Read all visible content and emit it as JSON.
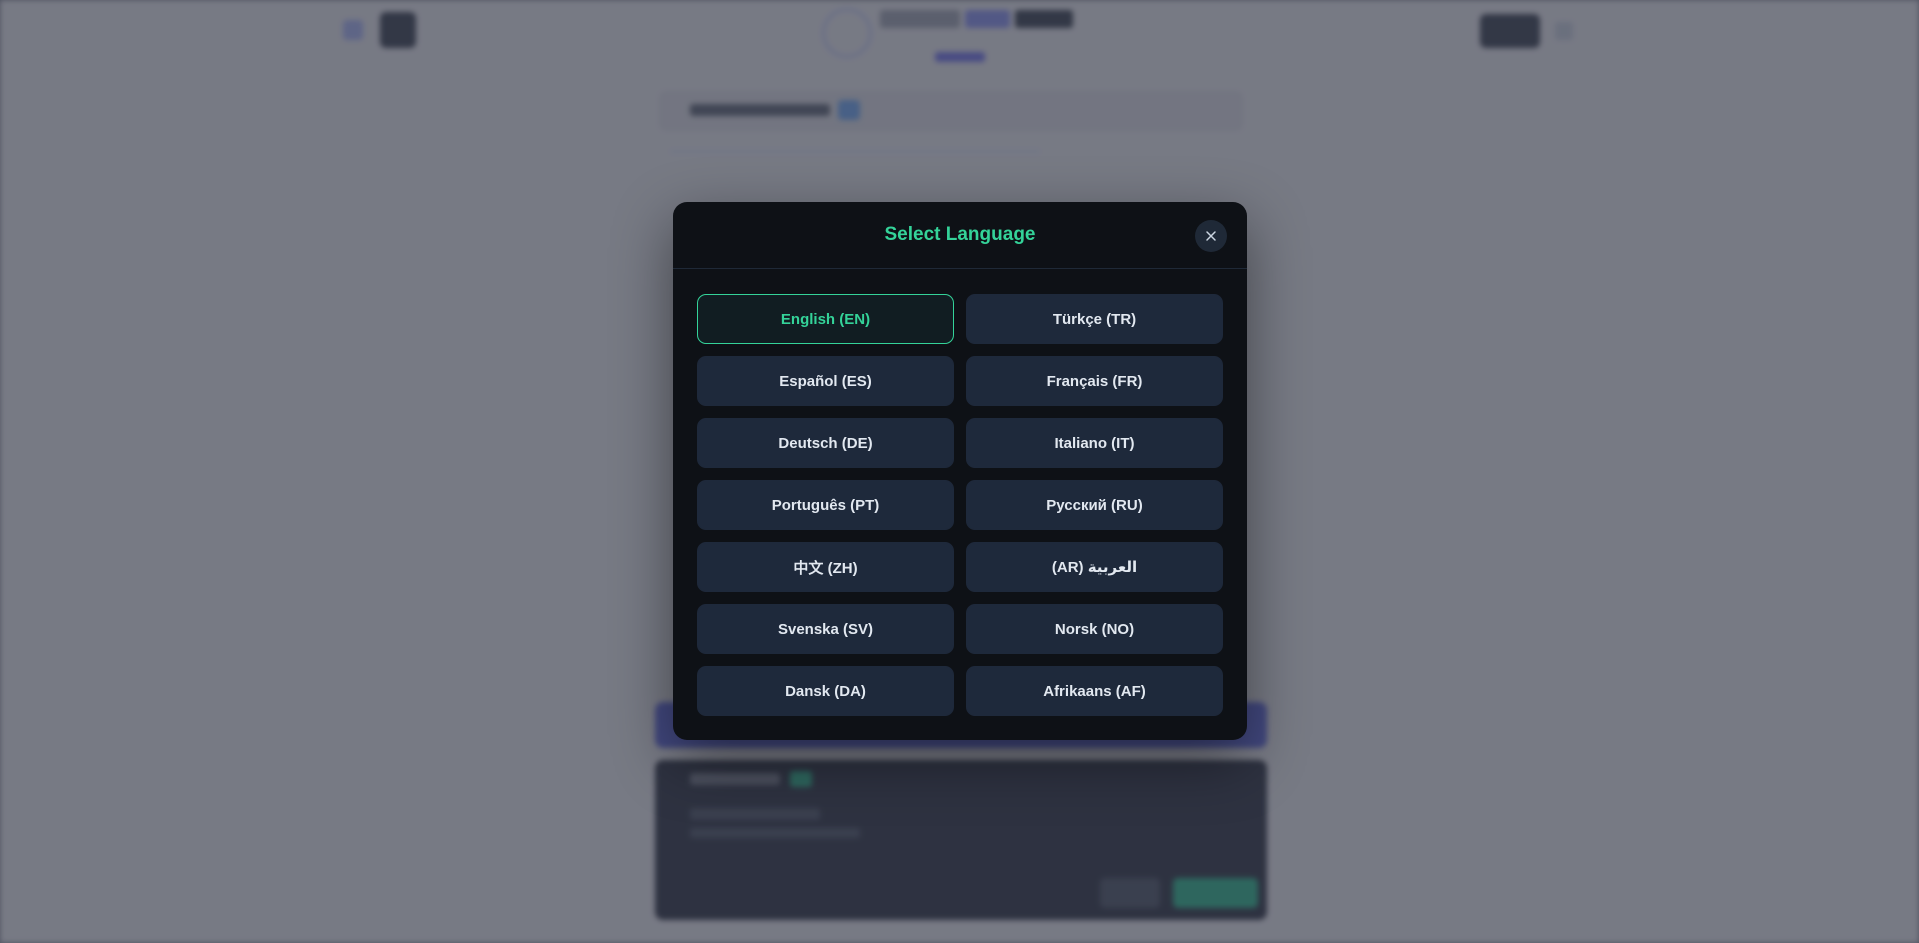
{
  "modal": {
    "title": "Select Language",
    "close_icon": "close-icon"
  },
  "languages": [
    {
      "label": "English (EN)",
      "selected": true
    },
    {
      "label": "Türkçe (TR)",
      "selected": false
    },
    {
      "label": "Español (ES)",
      "selected": false
    },
    {
      "label": "Français (FR)",
      "selected": false
    },
    {
      "label": "Deutsch (DE)",
      "selected": false
    },
    {
      "label": "Italiano (IT)",
      "selected": false
    },
    {
      "label": "Português (PT)",
      "selected": false
    },
    {
      "label": "Русский (RU)",
      "selected": false
    },
    {
      "label": "中文 (ZH)",
      "selected": false
    },
    {
      "label": "العربية (AR)",
      "selected": false
    },
    {
      "label": "Svenska (SV)",
      "selected": false
    },
    {
      "label": "Norsk (NO)",
      "selected": false
    },
    {
      "label": "Dansk (DA)",
      "selected": false
    },
    {
      "label": "Afrikaans (AF)",
      "selected": false
    }
  ],
  "colors": {
    "accent": "#34d399",
    "modal_bg": "#0e1116",
    "button_bg": "#1e293b",
    "button_text": "#e2e8f0"
  }
}
